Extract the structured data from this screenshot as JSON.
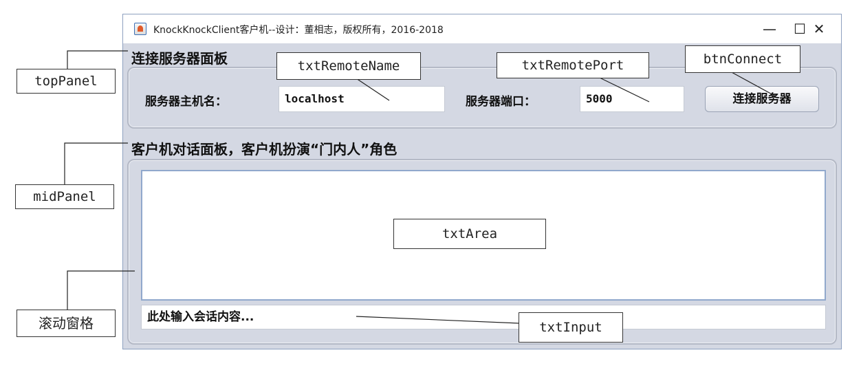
{
  "window": {
    "title": "KnockKnockClient客户机--设计：董相志，版权所有，2016-2018",
    "minimize_glyph": "—",
    "maximize_glyph": "☐",
    "close_glyph": "✕"
  },
  "top_panel": {
    "caption": "连接服务器面板",
    "host_label": "服务器主机名：",
    "host_value": "localhost",
    "port_label": "服务器端口：",
    "port_value": "5000",
    "connect_button": "连接服务器"
  },
  "mid_panel": {
    "caption": "客户机对话面板，客户机扮演“门内人”角色",
    "text_area_value": "",
    "input_value": "此处输入会话内容..."
  },
  "annotations": {
    "top_panel": "topPanel",
    "mid_panel": "midPanel",
    "scroll_pane": "滚动窗格",
    "txt_remote_name": "txtRemoteName",
    "txt_remote_port": "txtRemotePort",
    "btn_connect": "btnConnect",
    "txt_area": "txtArea",
    "txt_input": "txtInput"
  }
}
